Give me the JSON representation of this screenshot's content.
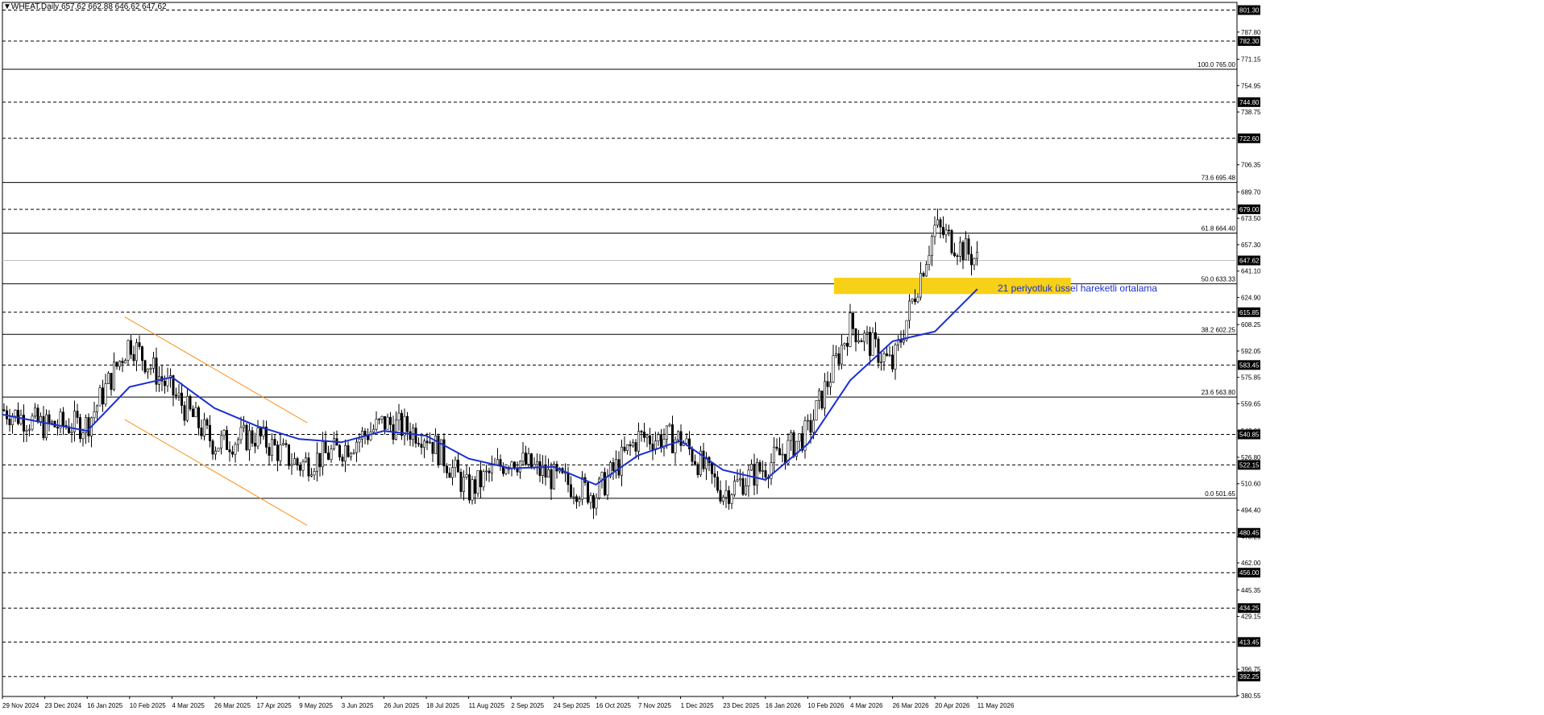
{
  "header": {
    "title": "▼WHEAT,Daily  657.62 662.88 646.62 647.62"
  },
  "annotation_ema": "21 periyotluk üssel hareketli ortalama",
  "colors": {
    "background": "#ffffff",
    "candle": "#000000",
    "ema": "#1a2fd1",
    "channel": "#f7931a",
    "zone": "#f7d117",
    "current_price_line": "#bfbfbf",
    "fib_line": "#000000",
    "dashed_level": "#000000"
  },
  "chart_data": {
    "type": "candlestick",
    "title": "WHEAT,Daily",
    "ohlc_last": {
      "open": 657.62,
      "high": 662.88,
      "low": 646.62,
      "close": 647.62
    },
    "ylim": [
      380,
      806
    ],
    "y_ticks": [
      "787.80",
      "771.15",
      "754.95",
      "738.75",
      "706.35",
      "689.70",
      "673.50",
      "657.30",
      "641.10",
      "624.90",
      "608.25",
      "592.05",
      "575.85",
      "559.65",
      "543.00",
      "526.80",
      "510.60",
      "494.40",
      "478.20",
      "462.00",
      "445.35",
      "429.15",
      "396.75",
      "380.55"
    ],
    "x_ticks": [
      "29 Nov 2024",
      "23 Dec 2024",
      "16 Jan 2025",
      "10 Feb 2025",
      "4 Mar 2025",
      "26 Mar 2025",
      "17 Apr 2025",
      "9 May 2025",
      "3 Jun 2025",
      "26 Jun 2025",
      "18 Jul 2025",
      "11 Aug 2025",
      "2 Sep 2025",
      "24 Sep 2025",
      "16 Oct 2025",
      "7 Nov 2025",
      "1 Dec 2025",
      "23 Dec 2025",
      "16 Jan 2026",
      "10 Feb 2026",
      "4 Mar 2026",
      "26 Mar 2026",
      "20 Apr 2026",
      "11 May 2026"
    ],
    "dashed_levels": [
      {
        "value": 801.3,
        "label": "801.30"
      },
      {
        "value": 782.3,
        "label": "782.30"
      },
      {
        "value": 744.8,
        "label": "744.80"
      },
      {
        "value": 722.6,
        "label": "722.60"
      },
      {
        "value": 679.0,
        "label": "679.00"
      },
      {
        "value": 615.85,
        "label": "615.85"
      },
      {
        "value": 583.45,
        "label": "583.45"
      },
      {
        "value": 540.85,
        "label": "540.85"
      },
      {
        "value": 522.15,
        "label": "522.15"
      },
      {
        "value": 480.45,
        "label": "480.45"
      },
      {
        "value": 456.0,
        "label": "456.00"
      },
      {
        "value": 434.25,
        "label": "434.25"
      },
      {
        "value": 413.45,
        "label": "413.45"
      },
      {
        "value": 392.25,
        "label": "392.25"
      }
    ],
    "fib_levels": [
      {
        "value": 765.0,
        "label": "100.0 765.00"
      },
      {
        "value": 695.48,
        "label": "73.6 695.48"
      },
      {
        "value": 664.4,
        "label": "61.8 664.40"
      },
      {
        "value": 633.33,
        "label": "50.0 633.33"
      },
      {
        "value": 602.25,
        "label": "38.2 602.25"
      },
      {
        "value": 563.8,
        "label": "23.6 563.80"
      },
      {
        "value": 501.65,
        "label": "0.0 501.65"
      }
    ],
    "current_price": {
      "value": 647.62,
      "label": "647.62"
    },
    "resistance_zone": {
      "from": "4 Mar 2026",
      "to": "11 May 2026",
      "low": 627,
      "high": 637
    },
    "channel": {
      "upper": [
        {
          "x": "10 Feb 2025",
          "y": 613
        },
        {
          "x": "9 May 2025",
          "y": 548
        }
      ],
      "lower": [
        {
          "x": "10 Feb 2025",
          "y": 550
        },
        {
          "x": "9 May 2025",
          "y": 485
        }
      ]
    },
    "ema_name": "21 periyotluk üssel hareketli ortalama",
    "ema": [
      [
        "29 Nov 2024",
        553
      ],
      [
        "23 Dec 2024",
        548
      ],
      [
        "16 Jan 2025",
        543
      ],
      [
        "10 Feb 2025",
        570
      ],
      [
        "4 Mar 2025",
        576
      ],
      [
        "26 Mar 2025",
        557
      ],
      [
        "17 Apr 2025",
        546
      ],
      [
        "9 May 2025",
        538
      ],
      [
        "3 Jun 2025",
        536
      ],
      [
        "26 Jun 2025",
        543
      ],
      [
        "18 Jul 2025",
        540
      ],
      [
        "11 Aug 2025",
        526
      ],
      [
        "2 Sep 2025",
        520
      ],
      [
        "24 Sep 2025",
        521
      ],
      [
        "16 Oct 2025",
        510
      ],
      [
        "7 Nov 2025",
        528
      ],
      [
        "1 Dec 2025",
        537
      ],
      [
        "23 Dec 2025",
        519
      ],
      [
        "16 Jan 2026",
        513
      ],
      [
        "10 Feb 2026",
        535
      ],
      [
        "4 Mar 2026",
        574
      ],
      [
        "26 Mar 2026",
        598
      ],
      [
        "20 Apr 2026",
        604
      ],
      [
        "11 May 2026",
        630
      ]
    ],
    "candles_close": [
      [
        "29 Nov 2024",
        556
      ],
      [
        "23 Dec 2024",
        546
      ],
      [
        "16 Jan 2025",
        547
      ],
      [
        "10 Feb 2025",
        598
      ],
      [
        "4 Mar 2025",
        567
      ],
      [
        "26 Mar 2025",
        535
      ],
      [
        "17 Apr 2025",
        540
      ],
      [
        "9 May 2025",
        522
      ],
      [
        "3 Jun 2025",
        532
      ],
      [
        "26 Jun 2025",
        548
      ],
      [
        "18 Jul 2025",
        541
      ],
      [
        "11 Aug 2025",
        506
      ],
      [
        "2 Sep 2025",
        527
      ],
      [
        "24 Sep 2025",
        514
      ],
      [
        "16 Oct 2025",
        504
      ],
      [
        "7 Nov 2025",
        539
      ],
      [
        "1 Dec 2025",
        538
      ],
      [
        "23 Dec 2025",
        505
      ],
      [
        "16 Jan 2026",
        521
      ],
      [
        "10 Feb 2026",
        542
      ],
      [
        "4 Mar 2026",
        608
      ],
      [
        "26 Mar 2026",
        583
      ],
      [
        "20 Apr 2026",
        668
      ],
      [
        "11 May 2026",
        647.62
      ]
    ],
    "grid": false,
    "legend": "none"
  }
}
